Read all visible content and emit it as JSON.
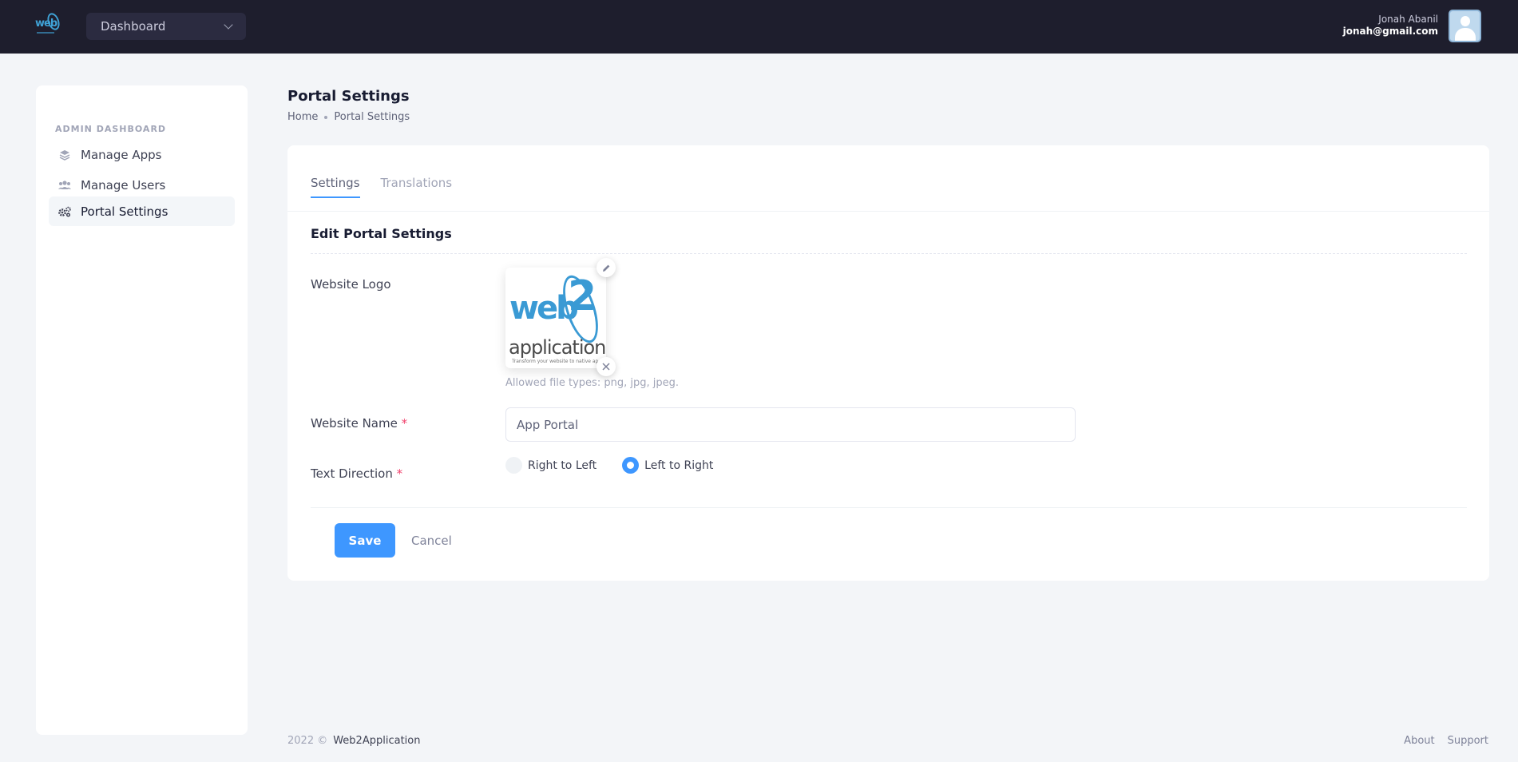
{
  "header": {
    "logo_icon": "web2application-logo",
    "dashboard_select": "Dashboard",
    "user_name": "Jonah Abanil",
    "user_email": "jonah@gmail.com"
  },
  "sidebar": {
    "section_title": "ADMIN DASHBOARD",
    "items": [
      {
        "label": "Manage Apps",
        "icon": "layers-icon"
      },
      {
        "label": "Manage Users",
        "icon": "users-icon"
      },
      {
        "label": "Portal Settings",
        "icon": "gears-icon",
        "active": true
      }
    ]
  },
  "page": {
    "title": "Portal Settings",
    "breadcrumb": [
      "Home",
      "Portal Settings"
    ]
  },
  "card": {
    "tabs": [
      "Settings",
      "Translations"
    ],
    "active_tab": "Settings",
    "section_title": "Edit Portal Settings",
    "logo_label": "Website Logo",
    "logo_image": {
      "word1": "web",
      "word2": "2",
      "word3": "application",
      "tagline": "Transform your website to native ap"
    },
    "allowed_types": "Allowed file types: png, jpg, jpeg.",
    "name_label": "Website Name",
    "name_value": "App Portal",
    "required_mark": "*",
    "direction_label": "Text Direction",
    "direction_options": [
      "Right to Left",
      "Left to Right"
    ],
    "direction_selected": "Left to Right",
    "save_label": "Save",
    "cancel_label": "Cancel"
  },
  "footer": {
    "year": "2022 ©",
    "company": "Web2Application",
    "links": [
      "About",
      "Support"
    ]
  },
  "colors": {
    "header_bg": "#1e1e2d",
    "primary": "#3e97ff",
    "required": "#f1416c"
  }
}
